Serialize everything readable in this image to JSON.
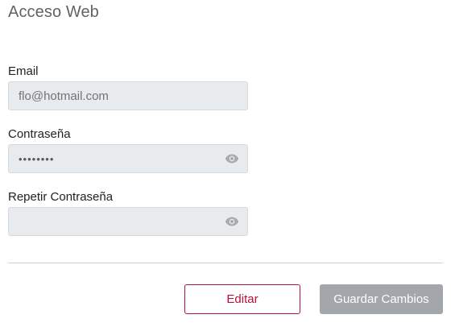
{
  "section": {
    "title": "Acceso Web"
  },
  "form": {
    "email": {
      "label": "Email",
      "value": "flo@hotmail.com"
    },
    "password": {
      "label": "Contraseña",
      "value": "••••••••"
    },
    "repeat_password": {
      "label": "Repetir Contraseña",
      "value": ""
    }
  },
  "actions": {
    "edit_label": "Editar",
    "save_label": "Guardar Cambios"
  },
  "icons": {
    "password_toggle": "eye-icon"
  },
  "colors": {
    "accent": "#b5123a",
    "disabled_button": "#a3a6aa",
    "field_background": "#e8ebee"
  }
}
